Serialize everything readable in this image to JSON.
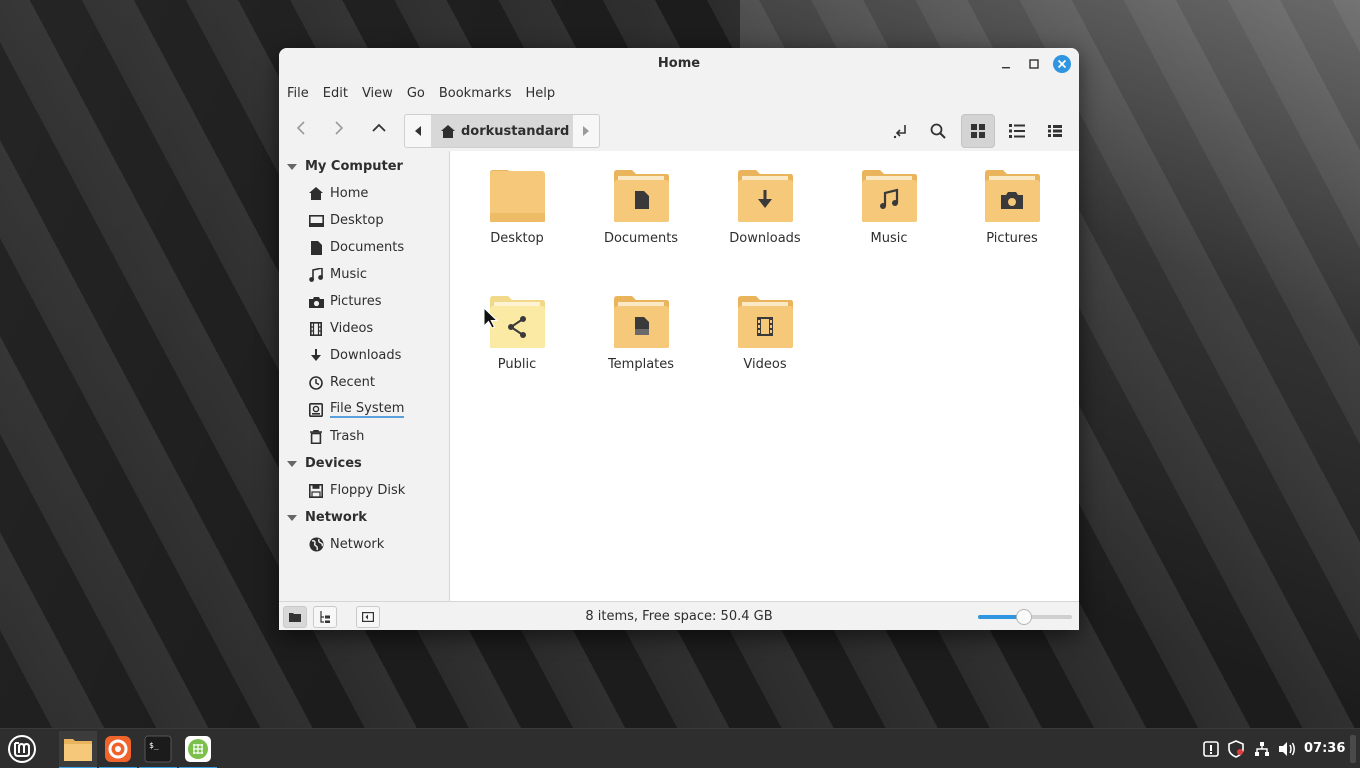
{
  "window": {
    "title": "Home"
  },
  "menubar": {
    "items": [
      "File",
      "Edit",
      "View",
      "Go",
      "Bookmarks",
      "Help"
    ]
  },
  "toolbar": {
    "path_crumb": "dorkustandard"
  },
  "sidebar": {
    "my_computer": {
      "label": "My Computer",
      "items": [
        {
          "label": "Home",
          "icon": "home-icon"
        },
        {
          "label": "Desktop",
          "icon": "desktop-icon"
        },
        {
          "label": "Documents",
          "icon": "document-icon"
        },
        {
          "label": "Music",
          "icon": "music-icon"
        },
        {
          "label": "Pictures",
          "icon": "camera-icon"
        },
        {
          "label": "Videos",
          "icon": "film-icon"
        },
        {
          "label": "Downloads",
          "icon": "download-icon"
        },
        {
          "label": "Recent",
          "icon": "clock-icon"
        },
        {
          "label": "File System",
          "icon": "drive-icon"
        },
        {
          "label": "Trash",
          "icon": "trash-icon"
        }
      ]
    },
    "devices": {
      "label": "Devices",
      "items": [
        {
          "label": "Floppy Disk",
          "icon": "floppy-icon"
        }
      ]
    },
    "network": {
      "label": "Network",
      "items": [
        {
          "label": "Network",
          "icon": "globe-icon"
        }
      ]
    }
  },
  "files": [
    {
      "name": "Desktop",
      "emblem": "none"
    },
    {
      "name": "Documents",
      "emblem": "document"
    },
    {
      "name": "Downloads",
      "emblem": "download"
    },
    {
      "name": "Music",
      "emblem": "music"
    },
    {
      "name": "Pictures",
      "emblem": "camera"
    },
    {
      "name": "Public",
      "emblem": "share"
    },
    {
      "name": "Templates",
      "emblem": "template"
    },
    {
      "name": "Videos",
      "emblem": "film"
    }
  ],
  "statusbar": {
    "text": "8 items, Free space: 50.4 GB",
    "zoom_fraction": 0.49
  },
  "taskbar": {
    "clock": "07:36"
  },
  "colors": {
    "accent": "#2f95e0",
    "folder": "#f6c879",
    "folder_dark": "#e9b45c"
  }
}
